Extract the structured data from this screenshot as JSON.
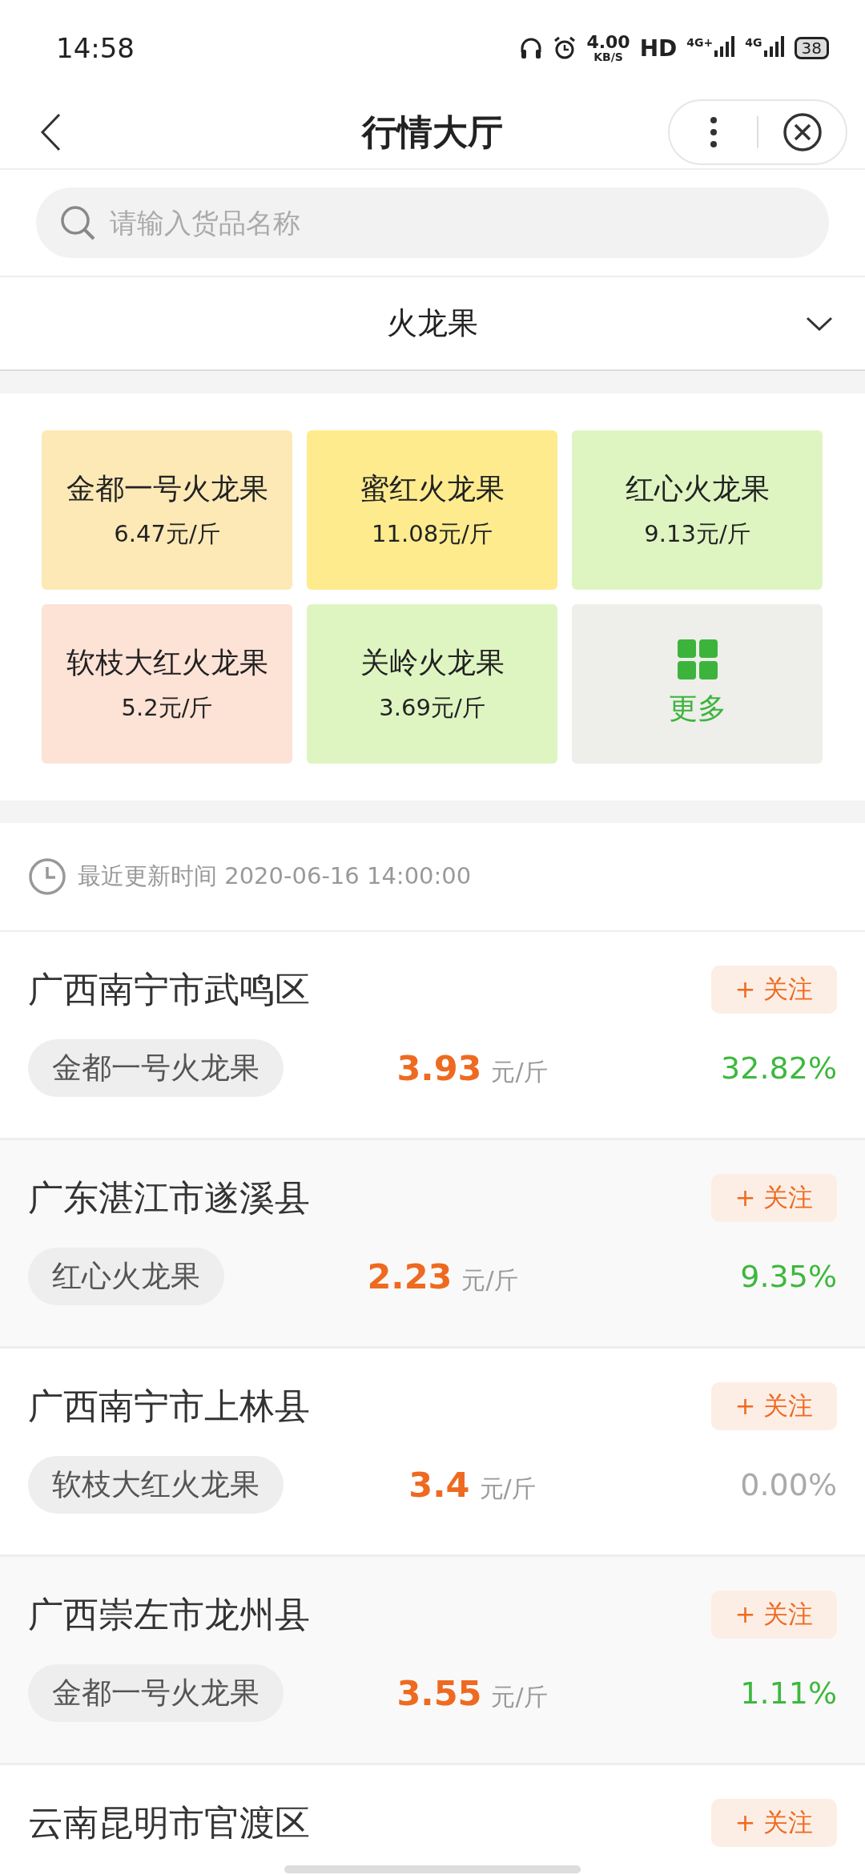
{
  "status_bar": {
    "time": "14:58",
    "speed": "4.00",
    "speed_unit": "KB/S",
    "hd": "HD",
    "sim1": "4G+",
    "sim2": "4G",
    "battery": "38"
  },
  "nav": {
    "title": "行情大厅"
  },
  "search": {
    "placeholder": "请输入货品名称"
  },
  "category": {
    "value": "火龙果"
  },
  "varieties": [
    {
      "kind": "variety",
      "name": "金都一号火龙果",
      "price": "6.47元/斤",
      "color": "#fde9b6"
    },
    {
      "kind": "variety",
      "name": "蜜红火龙果",
      "price": "11.08元/斤",
      "color": "#fdeb8e"
    },
    {
      "kind": "variety",
      "name": "红心火龙果",
      "price": "9.13元/斤",
      "color": "#def5c2"
    },
    {
      "kind": "variety",
      "name": "软枝大红火龙果",
      "price": "5.2元/斤",
      "color": "#fde2d6"
    },
    {
      "kind": "variety",
      "name": "关岭火龙果",
      "price": "3.69元/斤",
      "color": "#def5c2"
    },
    {
      "kind": "more",
      "name": "更多",
      "color": "#eeeeea"
    }
  ],
  "update_time": "最近更新时间 2020-06-16 14:00:00",
  "markets": [
    {
      "place": "广西南宁市武鸣区",
      "follow": "+ 关注",
      "variety": "金都一号火龙果",
      "price": "3.93",
      "unit": "元/斤",
      "change": "32.82%",
      "color": "#3db83d"
    },
    {
      "place": "广东湛江市遂溪县",
      "follow": "+ 关注",
      "variety": "红心火龙果",
      "price": "2.23",
      "unit": "元/斤",
      "change": "9.35%",
      "color": "#3db83d"
    },
    {
      "place": "广西南宁市上林县",
      "follow": "+ 关注",
      "variety": "软枝大红火龙果",
      "price": "3.4",
      "unit": "元/斤",
      "change": "0.00%",
      "color": "#aaaaaa"
    },
    {
      "place": "广西崇左市龙州县",
      "follow": "+ 关注",
      "variety": "金都一号火龙果",
      "price": "3.55",
      "unit": "元/斤",
      "change": "1.11%",
      "color": "#3db83d"
    },
    {
      "place": "云南昆明市官渡区",
      "follow": "+ 关注"
    }
  ]
}
